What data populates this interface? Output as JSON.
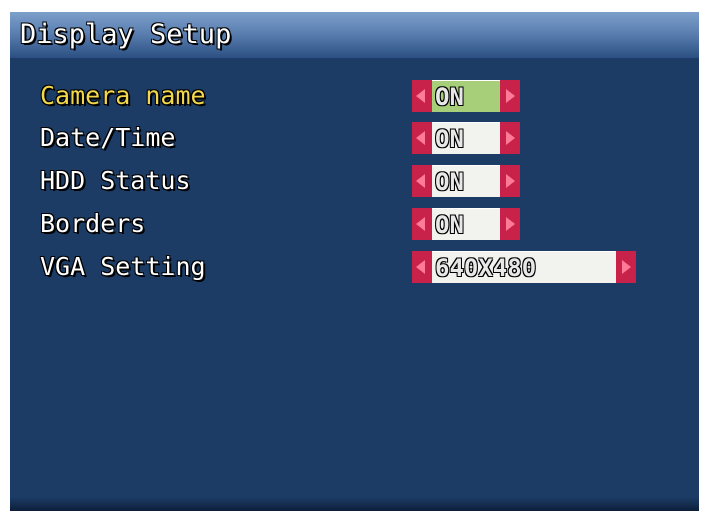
{
  "screen": {
    "title": "Display Setup"
  },
  "menu": {
    "items": [
      {
        "label": "Camera name",
        "value": "ON",
        "selected": true
      },
      {
        "label": "Date/Time",
        "value": "ON",
        "selected": false
      },
      {
        "label": "HDD Status",
        "value": "ON",
        "selected": false
      },
      {
        "label": "Borders",
        "value": "ON",
        "selected": false
      },
      {
        "label": "VGA Setting",
        "value": "640X480",
        "selected": false
      }
    ]
  },
  "icons": {
    "left_arrow": "chevron-left-icon",
    "right_arrow": "chevron-right-icon"
  },
  "colors": {
    "background": "#1c3c66",
    "title_bar": "#5b80b1",
    "selected_label": "#f2d84a",
    "label": "#ffffff",
    "arrow": "#c8224a",
    "value_box": "#f2f2ee",
    "value_box_active": "#a7cf7a"
  }
}
